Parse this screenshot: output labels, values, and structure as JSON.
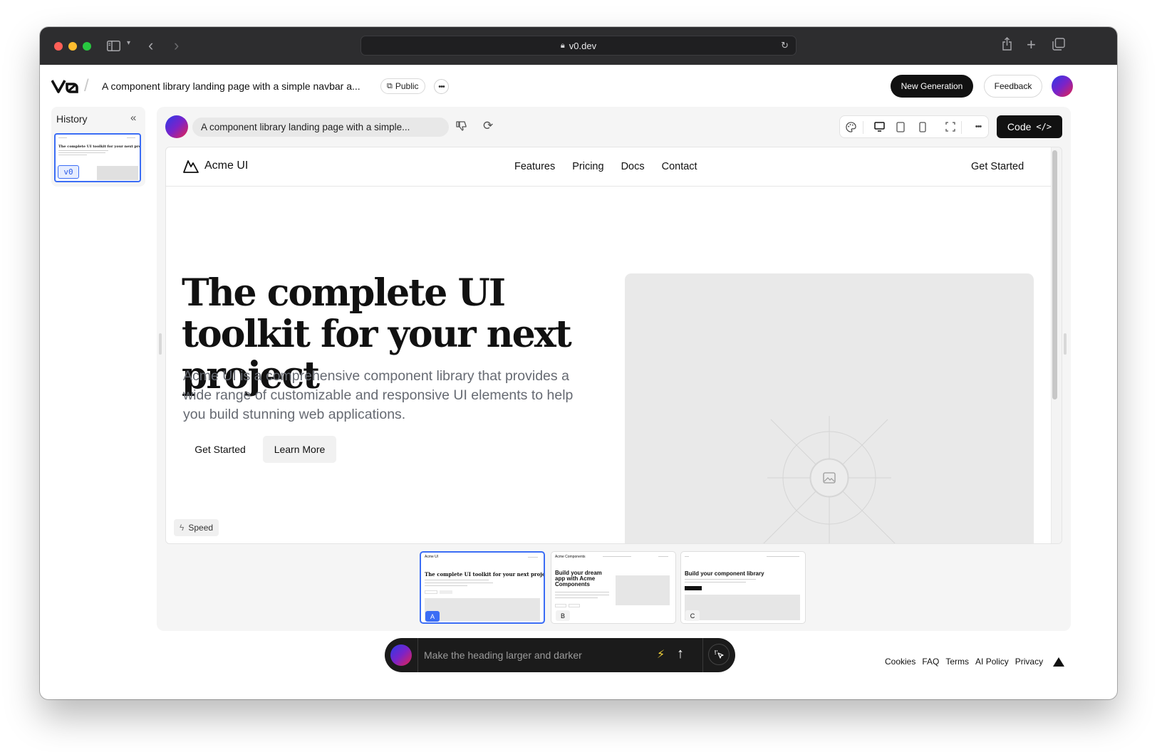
{
  "browser": {
    "url": "v0.dev",
    "traffic_colors": [
      "#ff5f57",
      "#febc2e",
      "#28c840"
    ]
  },
  "header": {
    "project_title": "A component library landing page with a simple navbar a...",
    "visibility": "Public",
    "new_generation_label": "New Generation",
    "feedback_label": "Feedback"
  },
  "history": {
    "title": "History",
    "item_badge": "v0"
  },
  "main": {
    "prompt_text": "A component library landing page with a simple...",
    "code_label": "Code"
  },
  "preview": {
    "brand": "Acme UI",
    "nav_links": [
      "Features",
      "Pricing",
      "Docs",
      "Contact"
    ],
    "nav_cta": "Get Started",
    "hero_title": "The complete UI toolkit for your next project",
    "hero_text": "Acme UI is a comprehensive component library that provides a wide range of customizable and responsive UI elements to help you build stunning web applications.",
    "primary_button": "Get Started",
    "secondary_button": "Learn More",
    "speed_badge": "Speed"
  },
  "variants": [
    {
      "letter": "A",
      "brand": "Acme UI",
      "headline": "The complete UI toolkit for your next project",
      "selected": true
    },
    {
      "letter": "B",
      "brand": "Acme Components",
      "headline": "Build your dream app with Acme Components",
      "selected": false
    },
    {
      "letter": "C",
      "brand": "",
      "headline": "Build your component library",
      "selected": false
    }
  ],
  "chat": {
    "placeholder": "Make the heading larger and darker"
  },
  "footer": {
    "links": [
      "Cookies",
      "FAQ",
      "Terms",
      "AI Policy",
      "Privacy"
    ]
  }
}
